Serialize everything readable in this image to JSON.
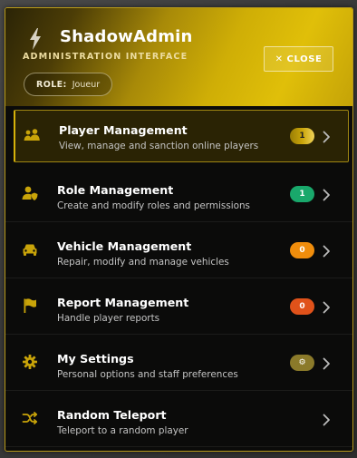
{
  "header": {
    "title": "ShadowAdmin",
    "subtitle": "ADMINISTRATION INTERFACE",
    "role_label": "ROLE:",
    "role_value": "Joueur",
    "close_label": "CLOSE",
    "close_glyph": "✕"
  },
  "menu": [
    {
      "name": "Player Management",
      "desc": "View, manage and sanction online players",
      "badge": "1",
      "badge_color": "#c9a409",
      "icon": "users-icon",
      "active": true
    },
    {
      "name": "Role Management",
      "desc": "Create and modify roles and permissions",
      "badge": "1",
      "badge_color": "#19a86b",
      "icon": "user-shield-icon"
    },
    {
      "name": "Vehicle Management",
      "desc": "Repair, modify and manage vehicles",
      "badge": "0",
      "badge_color": "#f08d0c",
      "icon": "car-icon"
    },
    {
      "name": "Report Management",
      "desc": "Handle player reports",
      "badge": "0",
      "badge_color": "#e0521a",
      "icon": "flag-icon"
    },
    {
      "name": "My Settings",
      "desc": "Personal options and staff preferences",
      "badge": "⚙",
      "badge_color": "#8b7a2a",
      "icon": "gear-icon"
    },
    {
      "name": "Random Teleport",
      "desc": "Teleport to a random player",
      "badge": null,
      "badge_color": null,
      "icon": "shuffle-icon"
    }
  ],
  "colors": {
    "accent": "#d6b20a",
    "icon": "#c9a409"
  }
}
